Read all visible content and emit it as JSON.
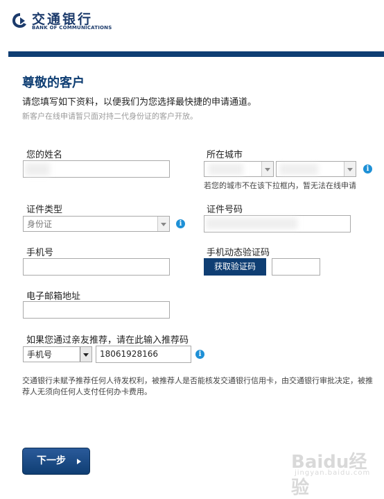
{
  "header": {
    "logo_cn": "交通银行",
    "logo_en": "BANK OF COMMUNICATIONS",
    "brand_color": "#0f3e73"
  },
  "page": {
    "title": "尊敬的客户",
    "subtitle": "请您填写如下资料，以便我们为您选择最快捷的申请通道。",
    "note": "新客户在线申请暂只面对持二代身份证的客户开放。"
  },
  "form": {
    "name_label": "您的姓名",
    "city_label": "所在城市",
    "city_hint": "若您的城市不在该下拉框内，暂无法在线申请",
    "id_type_label": "证件类型",
    "id_type_value": "身份证",
    "id_number_label": "证件号码",
    "phone_label": "手机号",
    "otp_label": "手机动态验证码",
    "otp_button": "获取验证码",
    "email_label": "电子邮箱地址",
    "referral_label": "如果您通过亲友推荐，请在此输入推荐码",
    "referral_type_value": "手机号",
    "referral_code_value": "18061928166",
    "info_icon": "info-icon"
  },
  "disclaimer": "交通银行未赋予推荐任何人待发权利，被推荐人是否能核发交通银行信用卡，由交通银行审批决定，被推荐人无须向任何人支付任何办卡费用。",
  "footer": {
    "next_button": "下一步",
    "watermark": "Baidu经验",
    "watermark_sub": "jingyan.baidu.com"
  }
}
